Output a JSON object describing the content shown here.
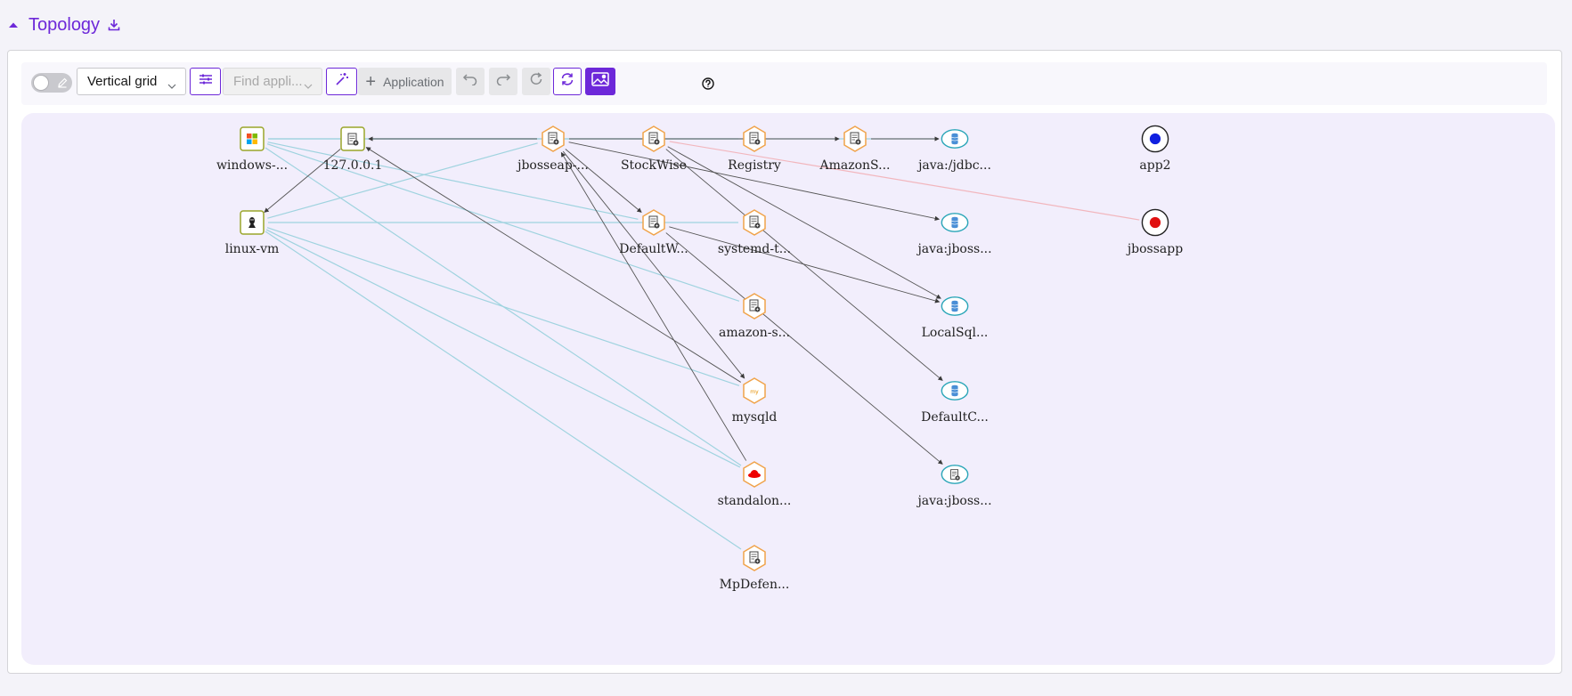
{
  "section": {
    "title": "Topology",
    "collapse_icon": "caret-up-icon",
    "export_icon": "download-icon"
  },
  "toolbar": {
    "edit_toggle_icon": "pencil-icon",
    "layout_select": "Vertical grid",
    "find_app_placeholder": "Find appli...",
    "add_application_label": "Application",
    "colors": {
      "accent": "#6d28d9"
    }
  },
  "graph": {
    "nodes": [
      {
        "id": "n-windows",
        "label": "windows-...",
        "kind": "windows-host"
      },
      {
        "id": "n-127",
        "label": "127.0.0.1",
        "kind": "host-file"
      },
      {
        "id": "n-jbosseap",
        "label": "jbosseap-...",
        "kind": "service"
      },
      {
        "id": "n-stockwise",
        "label": "StockWise",
        "kind": "service"
      },
      {
        "id": "n-registry",
        "label": "Registry",
        "kind": "service"
      },
      {
        "id": "n-amazonS",
        "label": "AmazonS...",
        "kind": "service"
      },
      {
        "id": "n-jdbc",
        "label": "java:/jdbc...",
        "kind": "datasource"
      },
      {
        "id": "n-app2",
        "label": "app2",
        "kind": "app-blue"
      },
      {
        "id": "n-linux",
        "label": "linux-vm",
        "kind": "linux-host"
      },
      {
        "id": "n-defaultw",
        "label": "DefaultW...",
        "kind": "service"
      },
      {
        "id": "n-systemd",
        "label": "systemd-t...",
        "kind": "service"
      },
      {
        "id": "n-jboss1",
        "label": "java:jboss...",
        "kind": "datasource"
      },
      {
        "id": "n-jbossapp",
        "label": "jbossapp",
        "kind": "app-red"
      },
      {
        "id": "n-amazons2",
        "label": "amazon-s...",
        "kind": "service"
      },
      {
        "id": "n-localsql",
        "label": "LocalSql...",
        "kind": "datasource"
      },
      {
        "id": "n-mysqld",
        "label": "mysqld",
        "kind": "mysql"
      },
      {
        "id": "n-defaultc",
        "label": "DefaultC...",
        "kind": "datasource"
      },
      {
        "id": "n-standalon",
        "label": "standalon...",
        "kind": "redhat"
      },
      {
        "id": "n-jboss2",
        "label": "java:jboss...",
        "kind": "jndi-file"
      },
      {
        "id": "n-mpdefen",
        "label": "MpDefen...",
        "kind": "service"
      }
    ],
    "edges": [
      {
        "from": "n-windows",
        "to": "n-jdbc",
        "style": "teal"
      },
      {
        "from": "n-windows",
        "to": "n-registry",
        "style": "teal"
      },
      {
        "from": "n-windows",
        "to": "n-defaultw",
        "style": "teal"
      },
      {
        "from": "n-windows",
        "to": "n-amazons2",
        "style": "teal"
      },
      {
        "from": "n-windows",
        "to": "n-standalon",
        "style": "teal"
      },
      {
        "from": "n-127",
        "to": "n-jbosseap",
        "style": "teal"
      },
      {
        "from": "n-127",
        "to": "n-linux",
        "style": "arrow"
      },
      {
        "from": "n-linux",
        "to": "n-jbosseap",
        "style": "teal"
      },
      {
        "from": "n-linux",
        "to": "n-systemd",
        "style": "teal"
      },
      {
        "from": "n-linux",
        "to": "n-mysqld",
        "style": "teal"
      },
      {
        "from": "n-linux",
        "to": "n-standalon",
        "style": "teal"
      },
      {
        "from": "n-linux",
        "to": "n-mpdefen",
        "style": "teal"
      },
      {
        "from": "n-jbosseap",
        "to": "n-127",
        "style": "arrow"
      },
      {
        "from": "n-jbosseap",
        "to": "n-mysqld",
        "style": "arrow"
      },
      {
        "from": "n-jbosseap",
        "to": "n-jboss1",
        "style": "arrow"
      },
      {
        "from": "n-jbosseap",
        "to": "n-defaultw",
        "style": "arrow"
      },
      {
        "from": "n-jbosseap",
        "to": "n-amazonS",
        "style": "arrow"
      },
      {
        "from": "n-amazonS",
        "to": "n-jdbc",
        "style": "arrow"
      },
      {
        "from": "n-stockwise",
        "to": "n-localsql",
        "style": "arrow"
      },
      {
        "from": "n-stockwise",
        "to": "n-defaultc",
        "style": "arrow"
      },
      {
        "from": "n-stockwise",
        "to": "n-jbossapp",
        "style": "pink"
      },
      {
        "from": "n-defaultw",
        "to": "n-jboss2",
        "style": "arrow"
      },
      {
        "from": "n-defaultw",
        "to": "n-localsql",
        "style": "arrow"
      },
      {
        "from": "n-standalon",
        "to": "n-jbosseap",
        "style": "arrow"
      },
      {
        "from": "n-mysqld",
        "to": "n-127",
        "style": "arrow"
      }
    ]
  }
}
